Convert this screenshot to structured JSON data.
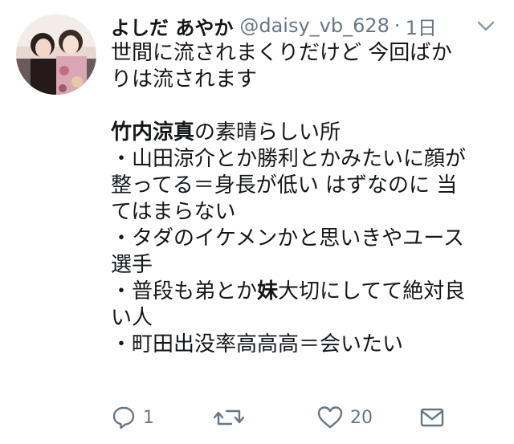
{
  "tweet": {
    "display_name": "よしだ あやか",
    "handle": "@daisy_vb_628",
    "separator": "·",
    "time": "1日",
    "body": {
      "line1": "世間に流されまくりだけど 今回ばか",
      "line2": "りは流されます",
      "line3_bold": "竹内涼真",
      "line3_rest": "の素晴らしい所",
      "line4": "・山田涼介とか勝利とかみたいに顔が",
      "line5": "整ってる＝身長が低い はずなのに 当",
      "line6": "てはまらない",
      "line7": "・タダのイケメンかと思いきやユース",
      "line8": "選手",
      "line9_pre": "・普段も弟とか",
      "line9_bold": "妹",
      "line9_post": "大切にしてて絶対良",
      "line10": "い人",
      "line11": "・町田出没率高高高＝会いたい"
    },
    "actions": {
      "reply_count": "1",
      "retweet_count": "",
      "like_count": "20"
    }
  },
  "icons": [
    "reply-icon",
    "retweet-icon",
    "like-icon",
    "message-icon",
    "chevron-down-icon"
  ],
  "colors": {
    "text": "#14171a",
    "secondary": "#657786",
    "background": "#ffffff"
  }
}
